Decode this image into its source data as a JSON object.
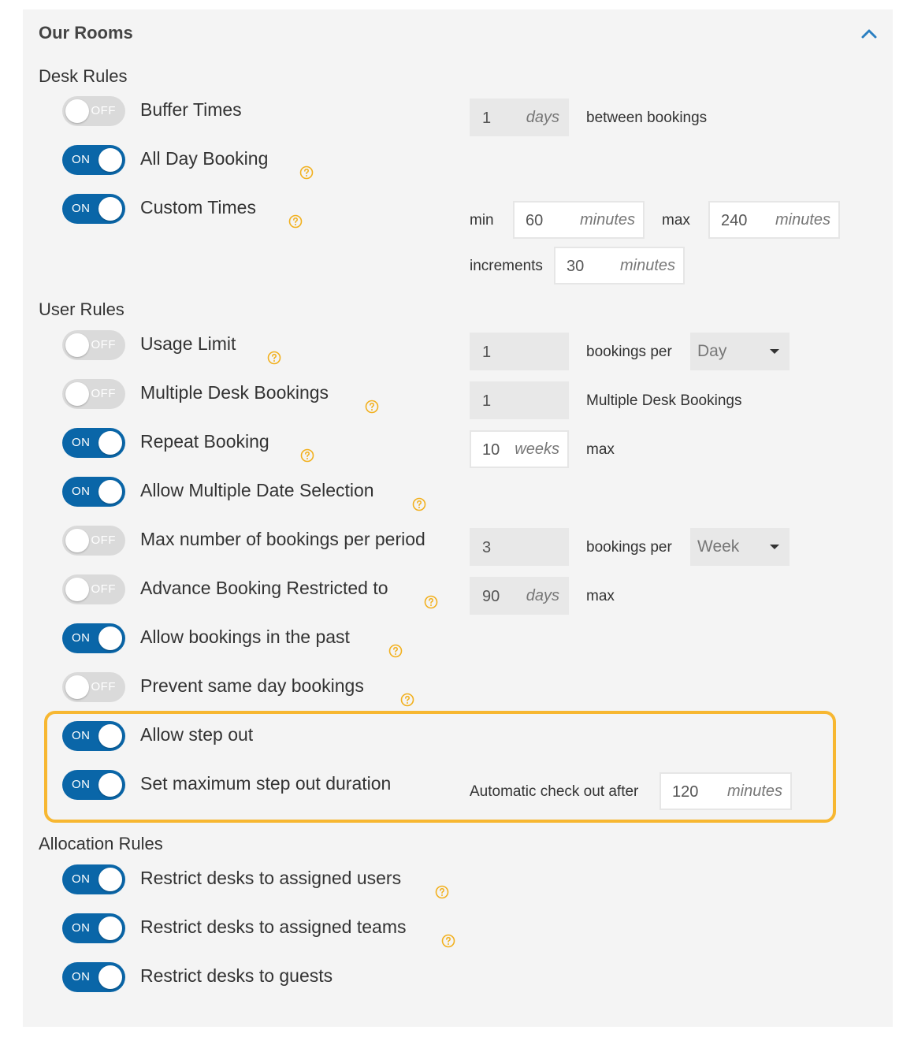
{
  "panel": {
    "title": "Our Rooms",
    "collapse_icon": "chevron-up-icon"
  },
  "colors": {
    "toggle_on": "#0a66a8",
    "toggle_off": "#dadada",
    "help_icon": "#f2b01e",
    "highlight": "#f7b731"
  },
  "sections": {
    "desk_rules": "Desk Rules",
    "user_rules": "User Rules",
    "allocation_rules": "Allocation Rules"
  },
  "toggle_text": {
    "on": "ON",
    "off": "OFF"
  },
  "rules": {
    "buffer_times": {
      "label": "Buffer Times",
      "state": "OFF"
    },
    "all_day_booking": {
      "label": "All Day Booking",
      "state": "ON"
    },
    "custom_times": {
      "label": "Custom Times",
      "state": "ON"
    },
    "usage_limit": {
      "label": "Usage Limit",
      "state": "OFF"
    },
    "multiple_desk_bookings": {
      "label": "Multiple Desk Bookings",
      "state": "OFF"
    },
    "repeat_booking": {
      "label": "Repeat Booking",
      "state": "ON"
    },
    "allow_multiple_date_selection": {
      "label": "Allow Multiple Date Selection",
      "state": "ON"
    },
    "max_bookings_per_period": {
      "label": "Max number of bookings per period",
      "state": "OFF"
    },
    "advance_booking_restricted": {
      "label": "Advance Booking Restricted to",
      "state": "OFF"
    },
    "allow_bookings_in_past": {
      "label": "Allow bookings in the past",
      "state": "ON"
    },
    "prevent_same_day": {
      "label": "Prevent same day bookings",
      "state": "OFF"
    },
    "allow_step_out": {
      "label": "Allow step out",
      "state": "ON"
    },
    "max_step_out_duration": {
      "label": "Set maximum step out duration",
      "state": "ON"
    },
    "restrict_assigned_users": {
      "label": "Restrict desks to assigned users",
      "state": "ON"
    },
    "restrict_assigned_teams": {
      "label": "Restrict desks to assigned teams",
      "state": "ON"
    },
    "restrict_guests": {
      "label": "Restrict desks to guests",
      "state": "ON"
    }
  },
  "fields": {
    "buffer": {
      "value": "1",
      "unit": "days",
      "suffix": "between bookings"
    },
    "custom_min": {
      "prefix": "min",
      "value": "60",
      "unit": "minutes"
    },
    "custom_max": {
      "prefix": "max",
      "value": "240",
      "unit": "minutes"
    },
    "custom_increments": {
      "prefix": "increments",
      "value": "30",
      "unit": "minutes"
    },
    "usage_limit": {
      "value": "1",
      "suffix": "bookings per",
      "period": "Day"
    },
    "multiple_desk": {
      "value": "1",
      "suffix": "Multiple Desk Bookings"
    },
    "repeat": {
      "value": "10",
      "unit": "weeks",
      "suffix": "max"
    },
    "max_per_period": {
      "value": "3",
      "suffix": "bookings per",
      "period": "Week"
    },
    "advance": {
      "value": "90",
      "unit": "days",
      "suffix": "max"
    },
    "step_out": {
      "prefix": "Automatic check out after",
      "value": "120",
      "unit": "minutes"
    }
  }
}
